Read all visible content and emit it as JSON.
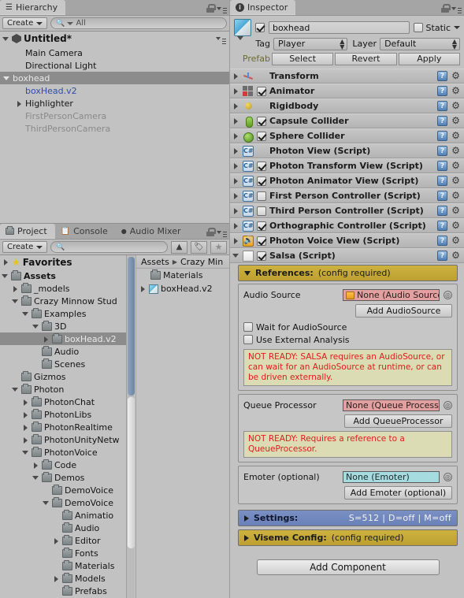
{
  "hierarchy": {
    "tab_label": "Hierarchy",
    "create_label": "Create",
    "search_placeholder": "All",
    "scene_name": "Untitled*",
    "items": [
      {
        "label": "Main Camera",
        "depth": 1,
        "arrow": "none",
        "state": "normal"
      },
      {
        "label": "Directional Light",
        "depth": 1,
        "arrow": "none",
        "state": "normal"
      },
      {
        "label": "boxhead",
        "depth": 0,
        "arrow": "down",
        "state": "selected"
      },
      {
        "label": "boxHead.v2",
        "depth": 1,
        "arrow": "none",
        "state": "prefab"
      },
      {
        "label": "Highlighter",
        "depth": 1,
        "arrow": "right",
        "state": "normal"
      },
      {
        "label": "FirstPersonCamera",
        "depth": 1,
        "arrow": "none",
        "state": "inactive"
      },
      {
        "label": "ThirdPersonCamera",
        "depth": 1,
        "arrow": "none",
        "state": "inactive"
      }
    ]
  },
  "project": {
    "tabs": [
      {
        "label": "Project",
        "active": true,
        "icon": "folder-icon"
      },
      {
        "label": "Console",
        "active": false,
        "icon": "console-icon"
      },
      {
        "label": "Audio Mixer",
        "active": false,
        "icon": "audio-mixer-icon"
      }
    ],
    "create_label": "Create",
    "search_placeholder": "",
    "favorites_label": "Favorites",
    "tree": [
      {
        "label": "Assets",
        "depth": 0,
        "arrow": "down",
        "bold": true,
        "selected": false
      },
      {
        "label": "_models",
        "depth": 1,
        "arrow": "right",
        "bold": false,
        "selected": false
      },
      {
        "label": "Crazy Minnow Stud",
        "depth": 1,
        "arrow": "down",
        "bold": false,
        "selected": false
      },
      {
        "label": "Examples",
        "depth": 2,
        "arrow": "down",
        "bold": false,
        "selected": false
      },
      {
        "label": "3D",
        "depth": 3,
        "arrow": "down",
        "bold": false,
        "selected": false
      },
      {
        "label": "boxHead.v2",
        "depth": 4,
        "arrow": "right",
        "bold": false,
        "selected": true
      },
      {
        "label": "Audio",
        "depth": 3,
        "arrow": "none",
        "bold": false,
        "selected": false
      },
      {
        "label": "Scenes",
        "depth": 3,
        "arrow": "none",
        "bold": false,
        "selected": false
      },
      {
        "label": "Gizmos",
        "depth": 1,
        "arrow": "none",
        "bold": false,
        "selected": false
      },
      {
        "label": "Photon",
        "depth": 1,
        "arrow": "down",
        "bold": false,
        "selected": false
      },
      {
        "label": "PhotonChat",
        "depth": 2,
        "arrow": "right",
        "bold": false,
        "selected": false
      },
      {
        "label": "PhotonLibs",
        "depth": 2,
        "arrow": "right",
        "bold": false,
        "selected": false
      },
      {
        "label": "PhotonRealtime",
        "depth": 2,
        "arrow": "right",
        "bold": false,
        "selected": false
      },
      {
        "label": "PhotonUnityNetw",
        "depth": 2,
        "arrow": "right",
        "bold": false,
        "selected": false
      },
      {
        "label": "PhotonVoice",
        "depth": 2,
        "arrow": "down",
        "bold": false,
        "selected": false
      },
      {
        "label": "Code",
        "depth": 3,
        "arrow": "right",
        "bold": false,
        "selected": false
      },
      {
        "label": "Demos",
        "depth": 3,
        "arrow": "down",
        "bold": false,
        "selected": false
      },
      {
        "label": "DemoVoice",
        "depth": 4,
        "arrow": "none",
        "bold": false,
        "selected": false
      },
      {
        "label": "DemoVoice",
        "depth": 4,
        "arrow": "down",
        "bold": false,
        "selected": false
      },
      {
        "label": "Animatio",
        "depth": 5,
        "arrow": "none",
        "bold": false,
        "selected": false
      },
      {
        "label": "Audio",
        "depth": 5,
        "arrow": "none",
        "bold": false,
        "selected": false
      },
      {
        "label": "Editor",
        "depth": 5,
        "arrow": "right",
        "bold": false,
        "selected": false
      },
      {
        "label": "Fonts",
        "depth": 5,
        "arrow": "none",
        "bold": false,
        "selected": false
      },
      {
        "label": "Materials",
        "depth": 5,
        "arrow": "none",
        "bold": false,
        "selected": false
      },
      {
        "label": "Models",
        "depth": 5,
        "arrow": "right",
        "bold": false,
        "selected": false
      },
      {
        "label": "Prefabs",
        "depth": 5,
        "arrow": "none",
        "bold": false,
        "selected": false
      }
    ],
    "breadcrumb": [
      "Assets",
      "Crazy Min"
    ],
    "contents": [
      {
        "label": "Materials",
        "icon": "folder-icon",
        "arrow": "none"
      },
      {
        "label": "boxHead.v2",
        "icon": "prefab-cube-icon",
        "arrow": "right"
      }
    ]
  },
  "inspector": {
    "tab_label": "Inspector",
    "object_name": "boxhead",
    "enabled": true,
    "static_label": "Static",
    "static_checked": false,
    "tag_label": "Tag",
    "tag_value": "Player",
    "layer_label": "Layer",
    "layer_value": "Default",
    "prefab_label": "Prefab",
    "prefab_buttons": [
      "Select",
      "Revert",
      "Apply"
    ],
    "components": [
      {
        "title": "Transform",
        "icon": "transform-icon",
        "has_toggle": false,
        "enabled": false,
        "expanded": false
      },
      {
        "title": "Animator",
        "icon": "animator-icon",
        "has_toggle": true,
        "enabled": true,
        "expanded": false
      },
      {
        "title": "Rigidbody",
        "icon": "rigidbody-icon",
        "has_toggle": false,
        "enabled": false,
        "expanded": false
      },
      {
        "title": "Capsule Collider",
        "icon": "capsule-collider-icon",
        "has_toggle": true,
        "enabled": true,
        "expanded": false
      },
      {
        "title": "Sphere Collider",
        "icon": "sphere-collider-icon",
        "has_toggle": true,
        "enabled": true,
        "expanded": false
      },
      {
        "title": "Photon View (Script)",
        "icon": "csharp-script-icon",
        "has_toggle": false,
        "enabled": false,
        "expanded": false
      },
      {
        "title": "Photon Transform View (Script)",
        "icon": "csharp-script-icon",
        "has_toggle": true,
        "enabled": true,
        "expanded": false
      },
      {
        "title": "Photon Animator View (Script)",
        "icon": "csharp-script-icon",
        "has_toggle": true,
        "enabled": true,
        "expanded": false
      },
      {
        "title": "First Person Controller (Script)",
        "icon": "csharp-script-icon",
        "has_toggle": true,
        "enabled": false,
        "expanded": false
      },
      {
        "title": "Third Person Controller (Script)",
        "icon": "csharp-script-icon",
        "has_toggle": true,
        "enabled": false,
        "expanded": false
      },
      {
        "title": "Orthographic Controller (Script)",
        "icon": "csharp-script-icon",
        "has_toggle": true,
        "enabled": true,
        "expanded": false
      },
      {
        "title": "Photon Voice View (Script)",
        "icon": "voice-speaker-icon",
        "has_toggle": true,
        "enabled": true,
        "expanded": false
      },
      {
        "title": "Salsa (Script)",
        "icon": "document-script-icon",
        "has_toggle": true,
        "enabled": true,
        "expanded": true
      }
    ],
    "help_icon_label": "?",
    "gear_icon_label": "⚙"
  },
  "salsa": {
    "references": {
      "title": "References:",
      "subtitle": "(config required)",
      "audio_source_label": "Audio Source",
      "audio_source_value": "None (Audio Source",
      "add_audiosource_label": "Add AudioSource",
      "wait_label": "Wait for AudioSource",
      "wait_checked": false,
      "external_label": "Use External Analysis",
      "external_checked": false,
      "warning_1": "NOT READY: SALSA requires an AudioSource, or can wait for an AudioSource at runtime, or can be driven externally.",
      "queue_label": "Queue Processor",
      "queue_value": "None (Queue Processo",
      "add_queue_label": "Add QueueProcessor",
      "warning_2": "NOT READY: Requires a reference to a QueueProcessor.",
      "emoter_label": "Emoter (optional)",
      "emoter_value": "None (Emoter)",
      "add_emoter_label": "Add Emoter (optional)"
    },
    "settings": {
      "title": "Settings:",
      "summary": "S=512 | D=off | M=off"
    },
    "viseme": {
      "title": "Viseme Config:",
      "subtitle": "(config required)"
    },
    "add_component_label": "Add Component"
  },
  "colors": {
    "gold_header": "#c5aa3a",
    "blue_header": "#7287bd",
    "warning_text": "#e01b1b",
    "warning_bg": "#dcdcb4",
    "pink_field": "#e2a0a0",
    "cyan_field": "#a6dbe0",
    "prefab_blue": "#2d4ea8",
    "selection_gray": "#8c8c8c"
  }
}
